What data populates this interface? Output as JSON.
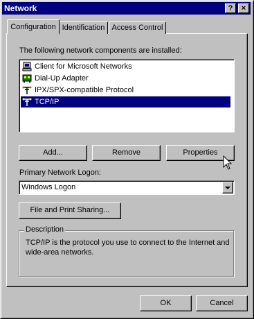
{
  "window": {
    "title": "Network"
  },
  "titlebar_buttons": {
    "help": "?",
    "close": "×"
  },
  "tabs": [
    {
      "label": "Configuration",
      "active": true
    },
    {
      "label": "Identification",
      "active": false
    },
    {
      "label": "Access Control",
      "active": false
    }
  ],
  "components": {
    "label": "The following network components are installed:",
    "items": [
      {
        "label": "Client for Microsoft Networks",
        "icon": "client-icon",
        "selected": false
      },
      {
        "label": "Dial-Up Adapter",
        "icon": "adapter-icon",
        "selected": false
      },
      {
        "label": "IPX/SPX-compatible Protocol",
        "icon": "protocol-icon",
        "selected": false
      },
      {
        "label": "TCP/IP",
        "icon": "protocol-icon",
        "selected": true
      }
    ]
  },
  "buttons": {
    "add": "Add...",
    "remove": "Remove",
    "properties": "Properties",
    "file_print": "File and Print Sharing...",
    "ok": "OK",
    "cancel": "Cancel"
  },
  "logon": {
    "label": "Primary Network Logon:",
    "value": "Windows Logon"
  },
  "description": {
    "title": "Description",
    "text": "TCP/IP is the protocol you use to connect to the Internet and wide-area networks."
  },
  "colors": {
    "titlebar": "#000080",
    "selection": "#000080",
    "face": "#c0c0c0"
  }
}
